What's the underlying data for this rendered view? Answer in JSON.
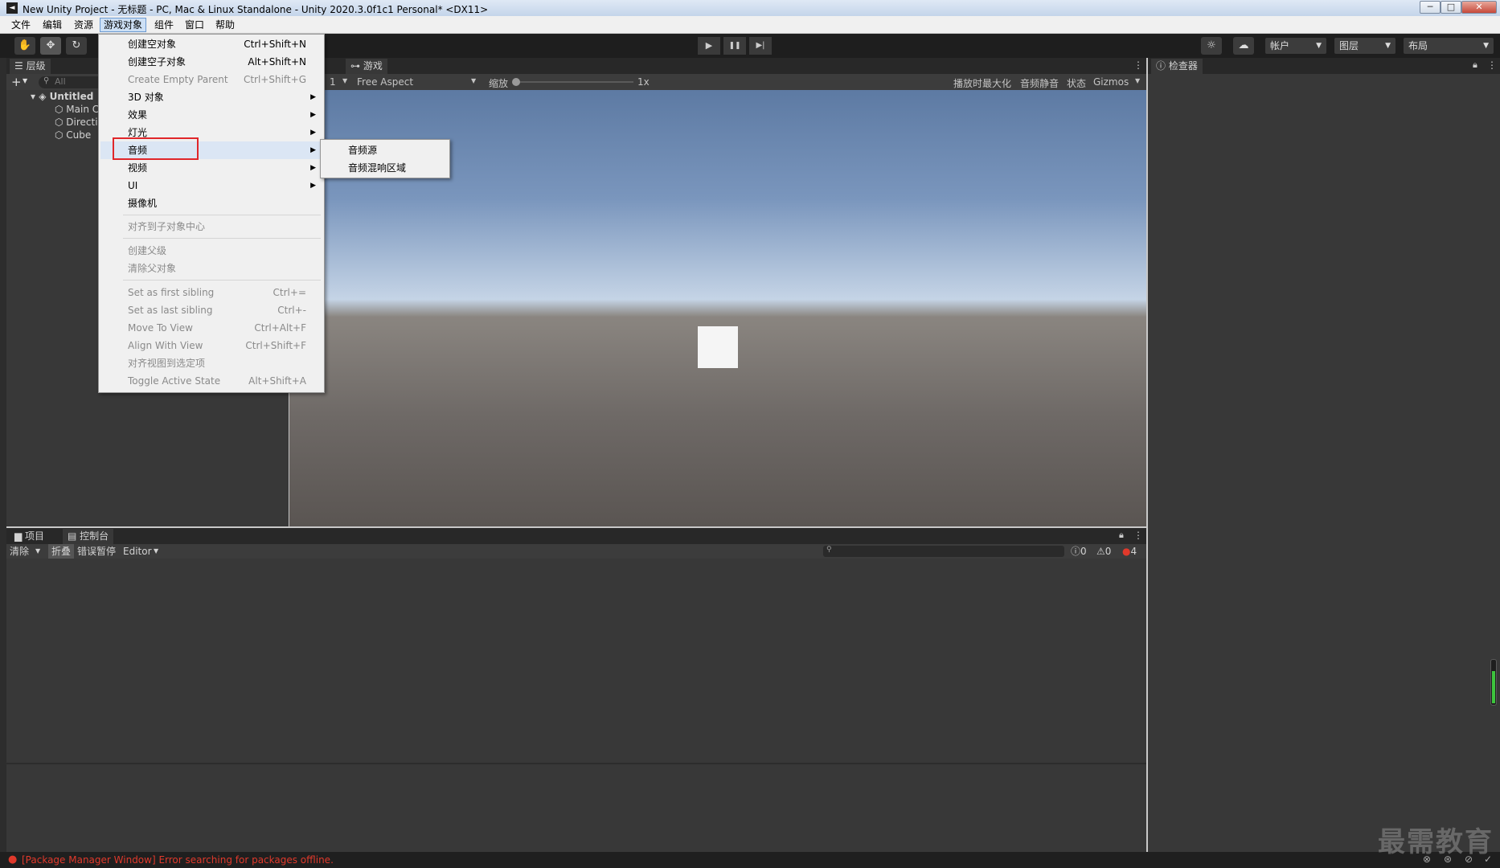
{
  "window": {
    "title": "New Unity Project - 无标题 - PC, Mac & Linux Standalone - Unity 2020.3.0f1c1 Personal* <DX11>",
    "logo": "◄",
    "controls": {
      "minimize": "─",
      "maximize": "□",
      "close": "✕"
    }
  },
  "menubar": {
    "items": [
      "文件",
      "编辑",
      "资源",
      "游戏对象",
      "组件",
      "窗口",
      "帮助"
    ],
    "active_index": 3
  },
  "toolbar": {
    "tools": [
      "hand-tool",
      "move-tool",
      "rotate-tool"
    ],
    "play": "▶",
    "pause": "❚❚",
    "step": "▶|",
    "account": "帐户",
    "layers": "图层",
    "layout": "布局"
  },
  "hierarchy": {
    "tab": "层级",
    "add": "+",
    "search_placeholder": "All",
    "scene": "Untitled",
    "objects": [
      "Main C",
      "Directi",
      "Cube"
    ]
  },
  "game": {
    "tab": "游戏",
    "display": "1",
    "aspect": "Free Aspect",
    "scale_label": "缩放",
    "scale_value": "1x",
    "options": [
      "播放时最大化",
      "音频静音",
      "状态",
      "Gizmos"
    ]
  },
  "inspector": {
    "tab": "检查器"
  },
  "context_menu": {
    "items": [
      {
        "label": "创建空对象",
        "shortcut": "Ctrl+Shift+N",
        "disabled": false
      },
      {
        "label": "创建空子对象",
        "shortcut": "Alt+Shift+N",
        "disabled": false
      },
      {
        "label": "Create Empty Parent",
        "shortcut": "Ctrl+Shift+G",
        "disabled": true
      },
      {
        "label": "3D 对象",
        "submenu": true
      },
      {
        "label": "效果",
        "submenu": true
      },
      {
        "label": "灯光",
        "submenu": true
      },
      {
        "label": "音频",
        "submenu": true,
        "highlighted": true
      },
      {
        "label": "视频",
        "submenu": true
      },
      {
        "label": "UI",
        "submenu": true
      },
      {
        "label": "摄像机"
      },
      {
        "label": "对齐到子对象中心",
        "disabled": true
      },
      {
        "label": "创建父级",
        "disabled": true
      },
      {
        "label": "清除父对象",
        "disabled": true
      },
      {
        "label": "Set as first sibling",
        "shortcut": "Ctrl+=",
        "disabled": true
      },
      {
        "label": "Set as last sibling",
        "shortcut": "Ctrl+-",
        "disabled": true
      },
      {
        "label": "Move To View",
        "shortcut": "Ctrl+Alt+F",
        "disabled": true
      },
      {
        "label": "Align With View",
        "shortcut": "Ctrl+Shift+F",
        "disabled": true
      },
      {
        "label": "对齐视图到选定项",
        "disabled": true
      },
      {
        "label": "Toggle Active State",
        "shortcut": "Alt+Shift+A",
        "disabled": true
      }
    ],
    "submenu_arrow": "▶",
    "audio_submenu": [
      "音频源",
      "音频混响区域"
    ]
  },
  "bottom": {
    "tabs": [
      "项目",
      "控制台"
    ],
    "console": {
      "clear": "清除",
      "collapse": "折叠",
      "error_pause": "错误暂停",
      "editor": "Editor",
      "search_placeholder": "",
      "log_count": "0",
      "warn_count": "0",
      "error_count": "4"
    }
  },
  "status": {
    "message": "[Package Manager Window] Error searching for packages offline.",
    "error_color": "#e0392b"
  },
  "watermark": "最需教育"
}
